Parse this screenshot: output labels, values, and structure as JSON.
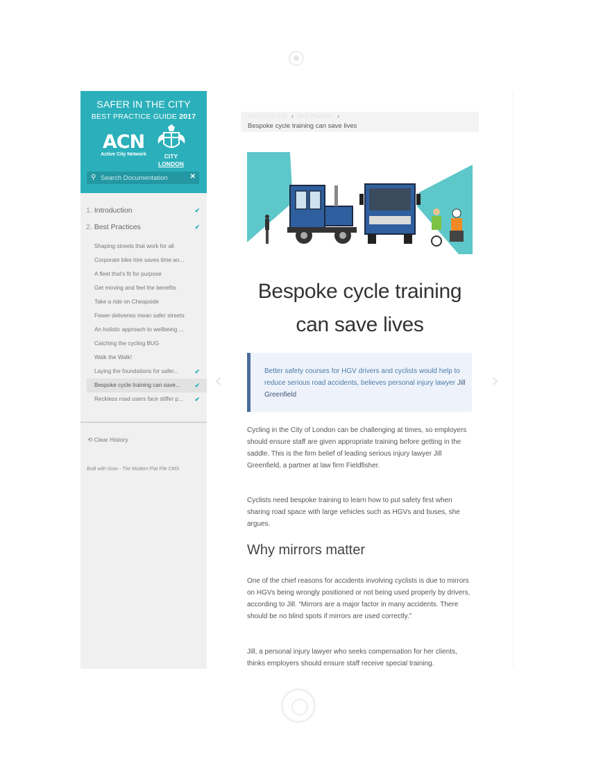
{
  "brand": {
    "title_line1": "SAFER IN THE CITY",
    "title_line2_a": "BEST PRACTICE GUIDE",
    "title_line2_b": "2017",
    "acn_mark": "ACN",
    "acn_sub": "Active City Network",
    "city_line1": "CITY",
    "city_line2": "LONDON"
  },
  "search": {
    "placeholder": "Search Documentation",
    "clear_icon": "close-icon"
  },
  "nav": {
    "top": [
      {
        "num": "1.",
        "label": "Introduction",
        "checked": true
      },
      {
        "num": "2.",
        "label": "Best Practices",
        "checked": true
      }
    ],
    "items": [
      {
        "label": "Shaping streets that work for all",
        "checked": false
      },
      {
        "label": "Corporate bike hire saves time an...",
        "checked": false
      },
      {
        "label": "A fleet that's fit for purpose",
        "checked": false
      },
      {
        "label": "Get moving and feel the benefits",
        "checked": false
      },
      {
        "label": "Take a ride on Cheapside",
        "checked": false
      },
      {
        "label": "Fewer deliveries mean safer streets",
        "checked": false
      },
      {
        "label": "An holistic approach to wellbeing ...",
        "checked": false
      },
      {
        "label": "Catching the cycling BUG",
        "checked": false
      },
      {
        "label": "Walk the Walk!",
        "checked": false
      },
      {
        "label": "Laying the foundations for safer...",
        "checked": true
      },
      {
        "label": "Bespoke cycle training can save...",
        "checked": true,
        "active": true
      },
      {
        "label": "Reckless road users face stiffer p...",
        "checked": true
      }
    ],
    "check_glyph": "✔"
  },
  "footer": {
    "clear_history": "Clear History",
    "built_with": "Built with Grav - The Modern Flat File CMS"
  },
  "breadcrumb": {
    "crumb1": "Safer in the City",
    "crumb2": "Best Practices",
    "current": "Bespoke cycle training can save lives"
  },
  "article": {
    "title_line1": "Bespoke cycle training",
    "title_line2": "can save lives",
    "quote_text": "Better safety courses for HGV drivers and cyclists would help to reduce serious road accidents, believes personal injury lawyer",
    "quote_name": "Jill Greenfield",
    "p1": "Cycling in the City of London can be challenging at times, so employers should ensure staff are given appropriate training before getting in the saddle. This is the firm belief of leading serious injury lawyer Jill Greenfield, a partner at law firm Fieldfisher.",
    "p2": "Cyclists need bespoke training to learn how to put safety first when sharing road space with large vehicles such as HGVs and buses, she argues.",
    "h2": "Why mirrors matter",
    "p3": "One of the chief reasons for accidents involving cyclists is due to mirrors on HGVs being wrongly positioned or not being used properly by drivers, according to Jill. “Mirrors are a major factor in many accidents. There should be no blind spots if mirrors are used correctly.”",
    "p4": "Jill, a personal injury lawyer who seeks compensation for her clients, thinks employers should ensure staff receive special training."
  },
  "colors": {
    "accent": "#2bb0bb",
    "quote_border": "#4a6c9b",
    "quote_bg": "#eef3fb"
  }
}
